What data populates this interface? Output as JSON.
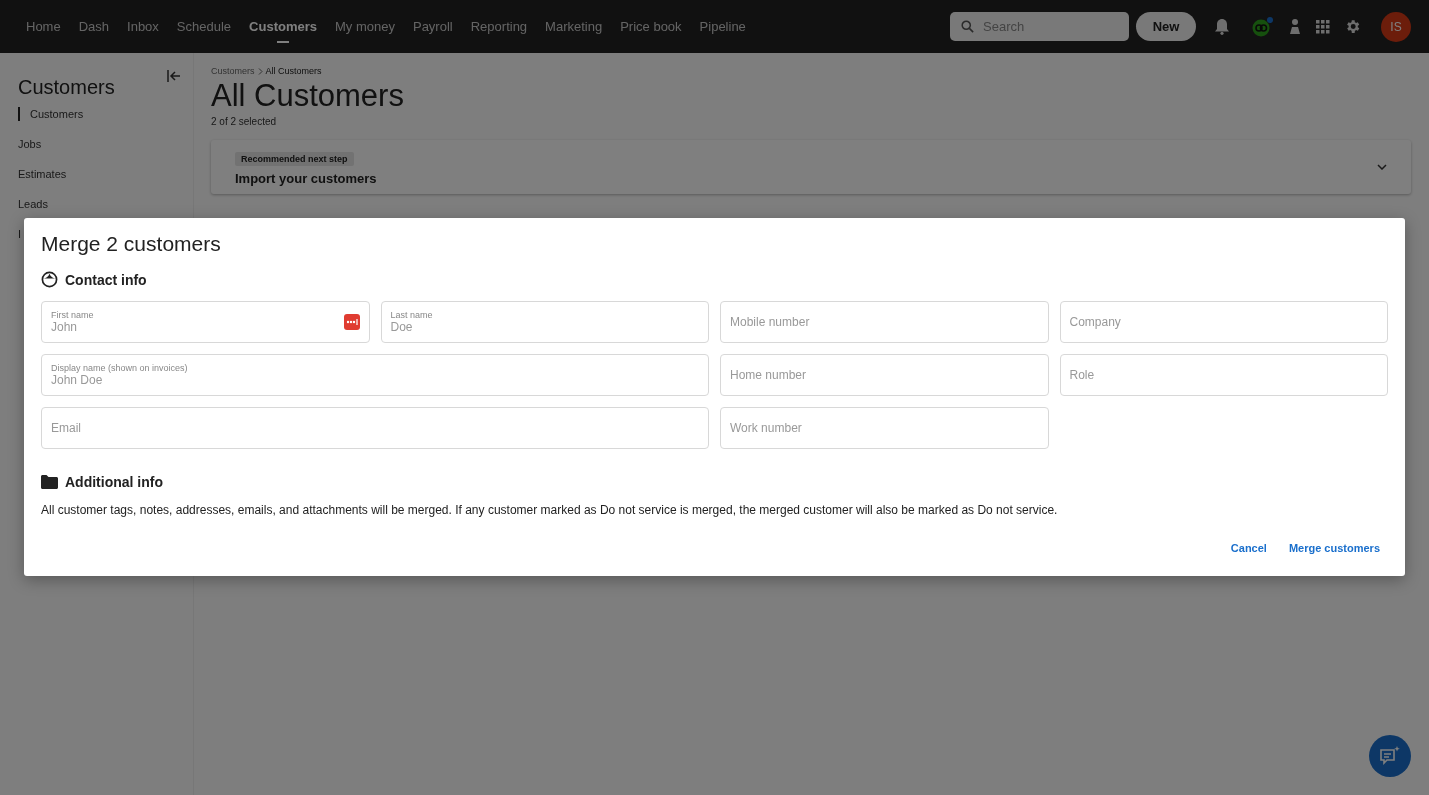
{
  "nav": {
    "items": [
      {
        "label": "Home",
        "selected": false
      },
      {
        "label": "Dash",
        "selected": false
      },
      {
        "label": "Inbox",
        "selected": false
      },
      {
        "label": "Schedule",
        "selected": false
      },
      {
        "label": "Customers",
        "selected": true
      },
      {
        "label": "My money",
        "selected": false
      },
      {
        "label": "Payroll",
        "selected": false
      },
      {
        "label": "Reporting",
        "selected": false
      },
      {
        "label": "Marketing",
        "selected": false
      },
      {
        "label": "Price book",
        "selected": false
      },
      {
        "label": "Pipeline",
        "selected": false
      }
    ],
    "search": {
      "placeholder": "Search"
    },
    "new_button": "New",
    "avatar": "IS"
  },
  "sidebar": {
    "title": "Customers",
    "items": [
      {
        "label": "Customers",
        "selected": true
      },
      {
        "label": "Jobs",
        "selected": false
      },
      {
        "label": "Estimates",
        "selected": false
      },
      {
        "label": "Leads",
        "selected": false
      },
      {
        "label": "I",
        "selected": false
      }
    ]
  },
  "main": {
    "breadcrumb": [
      "Customers",
      "All Customers"
    ],
    "title": "All Customers",
    "selection_count": "2 of 2 selected",
    "banner": {
      "tag": "Recommended next step",
      "title": "Import your customers",
      "expanded": false
    }
  },
  "modal": {
    "title": "Merge 2 customers",
    "contact_title": "Contact info",
    "fields": [
      {
        "label": "First name",
        "value": "John",
        "kind": "autofill"
      },
      {
        "label": "Last name",
        "value": "Doe",
        "kind": "plain"
      },
      {
        "placeholder": "Mobile number",
        "kind": "plain"
      },
      {
        "placeholder": "Company",
        "kind": "plain"
      },
      {
        "label": "Display name (shown on invoices)",
        "value": "John Doe",
        "kind": "wide"
      },
      {
        "placeholder": "Home number",
        "kind": "plain"
      },
      {
        "placeholder": "Role",
        "kind": "plain"
      },
      {
        "placeholder": "Email",
        "kind": "wide"
      },
      {
        "placeholder": "Work number",
        "kind": "plain"
      }
    ],
    "additional_title": "Additional info",
    "note": "All customer tags, notes, addresses, emails, and attachments will be merged. If any customer marked as Do not service is merged, the merged customer will also be marked as Do not service.",
    "buttons": [
      "Cancel",
      "Merge customers"
    ]
  }
}
